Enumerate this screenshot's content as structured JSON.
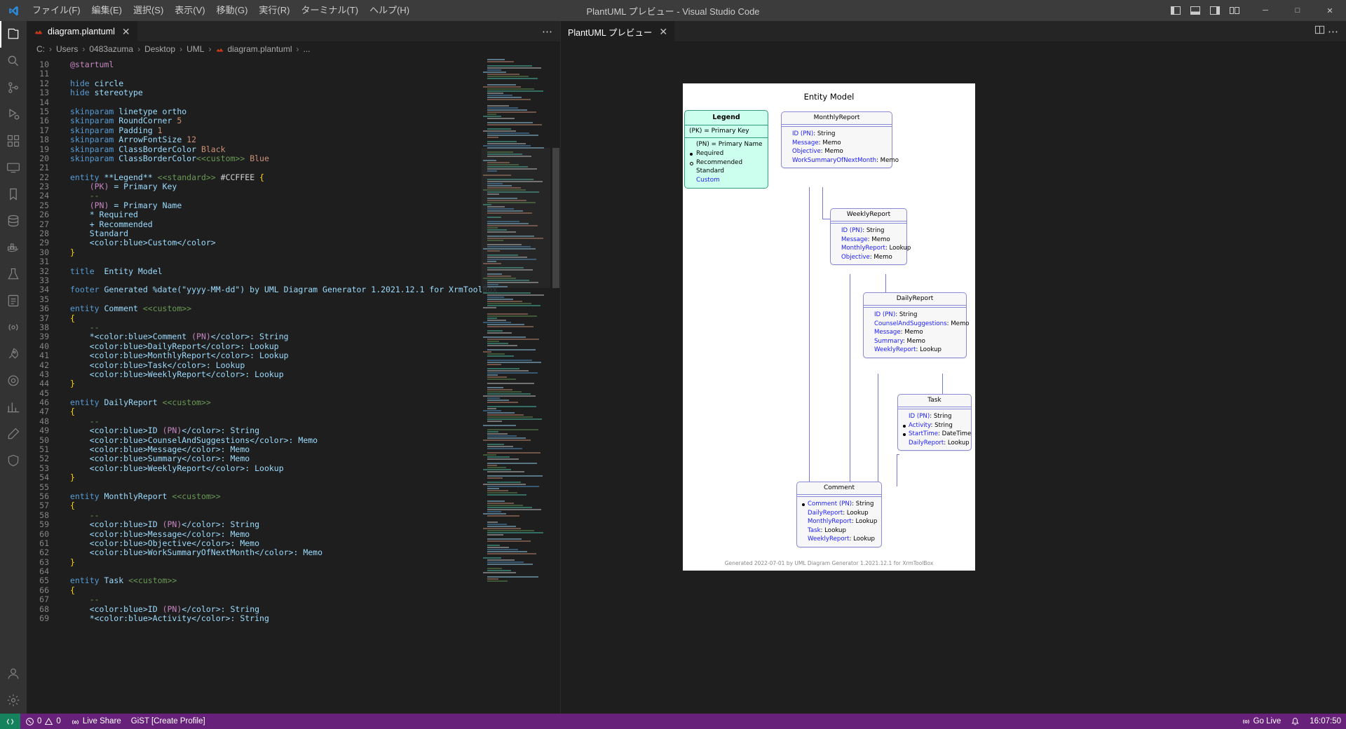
{
  "window": {
    "title": "PlantUML プレビュー - Visual Studio Code",
    "menus": [
      {
        "label": "ファイル(F)"
      },
      {
        "label": "編集(E)"
      },
      {
        "label": "選択(S)"
      },
      {
        "label": "表示(V)"
      },
      {
        "label": "移動(G)"
      },
      {
        "label": "実行(R)"
      },
      {
        "label": "ターミナル(T)"
      },
      {
        "label": "ヘルプ(H)"
      }
    ],
    "controls": {
      "minimize": "─",
      "maximize": "□",
      "close": "✕"
    }
  },
  "activitybar": {
    "items": [
      {
        "name": "explorer",
        "icon": "files-icon"
      },
      {
        "name": "search",
        "icon": "search-icon"
      },
      {
        "name": "source-control",
        "icon": "source-control-icon"
      },
      {
        "name": "run-debug",
        "icon": "run-debug-icon"
      },
      {
        "name": "extensions",
        "icon": "extensions-icon"
      },
      {
        "name": "remote-explorer",
        "icon": "remote-explorer-icon"
      },
      {
        "name": "bookmarks",
        "icon": "bookmark-icon"
      },
      {
        "name": "database",
        "icon": "database-icon"
      },
      {
        "name": "docker",
        "icon": "docker-icon"
      },
      {
        "name": "testing",
        "icon": "beaker-icon"
      },
      {
        "name": "todo-tree",
        "icon": "checklist-icon"
      },
      {
        "name": "live-share",
        "icon": "live-share-icon"
      },
      {
        "name": "rocket",
        "icon": "rocket-icon"
      },
      {
        "name": "settings-gear-alt",
        "icon": "gear-alt-icon"
      },
      {
        "name": "chart",
        "icon": "chart-icon"
      },
      {
        "name": "pencil",
        "icon": "pencil-icon"
      },
      {
        "name": "shield",
        "icon": "shield-icon"
      }
    ],
    "bottom": [
      {
        "name": "accounts",
        "icon": "account-icon"
      },
      {
        "name": "manage",
        "icon": "gear-icon"
      }
    ]
  },
  "editor": {
    "tab": {
      "label": "diagram.plantuml",
      "close": "✕",
      "icon": "plantuml-file-icon"
    },
    "tab_actions": {
      "more": "⋯"
    },
    "breadcrumb": [
      "C:",
      "Users",
      "0483azuma",
      "Desktop",
      "UML",
      "diagram.plantuml",
      "..."
    ],
    "breadcrumb_separator": "›",
    "first_line_number": 10,
    "code_lines": [
      {
        "n": 10,
        "tokens": [
          {
            "t": "@startuml",
            "c": "k-pink"
          }
        ]
      },
      {
        "n": 11,
        "tokens": []
      },
      {
        "n": 12,
        "tokens": [
          {
            "t": "hide ",
            "c": "k-blue"
          },
          {
            "t": "circle",
            "c": "k-lblue"
          }
        ]
      },
      {
        "n": 13,
        "tokens": [
          {
            "t": "hide ",
            "c": "k-blue"
          },
          {
            "t": "stereotype",
            "c": "k-lblue"
          }
        ]
      },
      {
        "n": 14,
        "tokens": []
      },
      {
        "n": 15,
        "tokens": [
          {
            "t": "skinparam ",
            "c": "k-blue"
          },
          {
            "t": "linetype ortho",
            "c": "k-lblue"
          }
        ]
      },
      {
        "n": 16,
        "tokens": [
          {
            "t": "skinparam ",
            "c": "k-blue"
          },
          {
            "t": "RoundCorner ",
            "c": "k-lblue"
          },
          {
            "t": "5",
            "c": "k-orange"
          }
        ]
      },
      {
        "n": 17,
        "tokens": [
          {
            "t": "skinparam ",
            "c": "k-blue"
          },
          {
            "t": "Padding ",
            "c": "k-lblue"
          },
          {
            "t": "1",
            "c": "k-orange"
          }
        ]
      },
      {
        "n": 18,
        "tokens": [
          {
            "t": "skinparam ",
            "c": "k-blue"
          },
          {
            "t": "ArrowFontSize ",
            "c": "k-lblue"
          },
          {
            "t": "12",
            "c": "k-orange"
          }
        ]
      },
      {
        "n": 19,
        "tokens": [
          {
            "t": "skinparam ",
            "c": "k-blue"
          },
          {
            "t": "ClassBorderColor ",
            "c": "k-lblue"
          },
          {
            "t": "Black",
            "c": "k-orange"
          }
        ]
      },
      {
        "n": 20,
        "tokens": [
          {
            "t": "skinparam ",
            "c": "k-blue"
          },
          {
            "t": "ClassBorderColor",
            "c": "k-lblue"
          },
          {
            "t": "<<custom>>",
            "c": "k-green"
          },
          {
            "t": " Blue",
            "c": "k-orange"
          }
        ]
      },
      {
        "n": 21,
        "tokens": []
      },
      {
        "n": 22,
        "tokens": [
          {
            "t": "entity ",
            "c": "k-blue"
          },
          {
            "t": "**Legend** ",
            "c": "k-lblue"
          },
          {
            "t": "<<standard>>",
            "c": "k-green"
          },
          {
            "t": " #CCFFEE ",
            "c": "k-white"
          },
          {
            "t": "{",
            "c": "k-brace"
          }
        ]
      },
      {
        "n": 23,
        "tokens": [
          {
            "t": "    ",
            "c": "k-white"
          },
          {
            "t": "(PK)",
            "c": "k-pink"
          },
          {
            "t": " = Primary Key",
            "c": "k-lblue"
          }
        ]
      },
      {
        "n": 24,
        "tokens": [
          {
            "t": "    --",
            "c": "k-green"
          }
        ]
      },
      {
        "n": 25,
        "tokens": [
          {
            "t": "    ",
            "c": "k-white"
          },
          {
            "t": "(PN)",
            "c": "k-pink"
          },
          {
            "t": " = Primary Name",
            "c": "k-lblue"
          }
        ]
      },
      {
        "n": 26,
        "tokens": [
          {
            "t": "    * Required",
            "c": "k-lblue"
          }
        ]
      },
      {
        "n": 27,
        "tokens": [
          {
            "t": "    + Recommended",
            "c": "k-lblue"
          }
        ]
      },
      {
        "n": 28,
        "tokens": [
          {
            "t": "    Standard",
            "c": "k-lblue"
          }
        ]
      },
      {
        "n": 29,
        "tokens": [
          {
            "t": "    <color:blue>Custom</color>",
            "c": "k-lblue"
          }
        ]
      },
      {
        "n": 30,
        "tokens": [
          {
            "t": "}",
            "c": "k-brace"
          }
        ]
      },
      {
        "n": 31,
        "tokens": []
      },
      {
        "n": 32,
        "tokens": [
          {
            "t": "title ",
            "c": "k-blue"
          },
          {
            "t": " Entity Model",
            "c": "k-lblue"
          }
        ]
      },
      {
        "n": 33,
        "tokens": []
      },
      {
        "n": 34,
        "tokens": [
          {
            "t": "footer ",
            "c": "k-blue"
          },
          {
            "t": "Generated %date(\"yyyy-MM-dd\") by UML Diagram Generator 1.2021.12.1 for XrmToolBox",
            "c": "k-lblue"
          }
        ]
      },
      {
        "n": 35,
        "tokens": []
      },
      {
        "n": 36,
        "tokens": [
          {
            "t": "entity ",
            "c": "k-blue"
          },
          {
            "t": "Comment ",
            "c": "k-lblue"
          },
          {
            "t": "<<custom>>",
            "c": "k-green"
          }
        ]
      },
      {
        "n": 37,
        "tokens": [
          {
            "t": "{",
            "c": "k-brace"
          }
        ]
      },
      {
        "n": 38,
        "tokens": [
          {
            "t": "    --",
            "c": "k-green"
          }
        ]
      },
      {
        "n": 39,
        "tokens": [
          {
            "t": "    *<color:blue>Comment ",
            "c": "k-lblue"
          },
          {
            "t": "(PN)",
            "c": "k-pink"
          },
          {
            "t": "</color>: String",
            "c": "k-lblue"
          }
        ]
      },
      {
        "n": 40,
        "tokens": [
          {
            "t": "    <color:blue>DailyReport</color>: Lookup",
            "c": "k-lblue"
          }
        ]
      },
      {
        "n": 41,
        "tokens": [
          {
            "t": "    <color:blue>MonthlyReport</color>: Lookup",
            "c": "k-lblue"
          }
        ]
      },
      {
        "n": 42,
        "tokens": [
          {
            "t": "    <color:blue>Task</color>: Lookup",
            "c": "k-lblue"
          }
        ]
      },
      {
        "n": 43,
        "tokens": [
          {
            "t": "    <color:blue>WeeklyReport</color>: Lookup",
            "c": "k-lblue"
          }
        ]
      },
      {
        "n": 44,
        "tokens": [
          {
            "t": "}",
            "c": "k-brace"
          }
        ]
      },
      {
        "n": 45,
        "tokens": []
      },
      {
        "n": 46,
        "tokens": [
          {
            "t": "entity ",
            "c": "k-blue"
          },
          {
            "t": "DailyReport ",
            "c": "k-lblue"
          },
          {
            "t": "<<custom>>",
            "c": "k-green"
          }
        ]
      },
      {
        "n": 47,
        "tokens": [
          {
            "t": "{",
            "c": "k-brace"
          }
        ]
      },
      {
        "n": 48,
        "tokens": [
          {
            "t": "    --",
            "c": "k-green"
          }
        ]
      },
      {
        "n": 49,
        "tokens": [
          {
            "t": "    <color:blue>ID ",
            "c": "k-lblue"
          },
          {
            "t": "(PN)",
            "c": "k-pink"
          },
          {
            "t": "</color>: String",
            "c": "k-lblue"
          }
        ]
      },
      {
        "n": 50,
        "tokens": [
          {
            "t": "    <color:blue>CounselAndSuggestions</color>: Memo",
            "c": "k-lblue"
          }
        ]
      },
      {
        "n": 51,
        "tokens": [
          {
            "t": "    <color:blue>Message</color>: Memo",
            "c": "k-lblue"
          }
        ]
      },
      {
        "n": 52,
        "tokens": [
          {
            "t": "    <color:blue>Summary</color>: Memo",
            "c": "k-lblue"
          }
        ]
      },
      {
        "n": 53,
        "tokens": [
          {
            "t": "    <color:blue>WeeklyReport</color>: Lookup",
            "c": "k-lblue"
          }
        ]
      },
      {
        "n": 54,
        "tokens": [
          {
            "t": "}",
            "c": "k-brace"
          }
        ]
      },
      {
        "n": 55,
        "tokens": []
      },
      {
        "n": 56,
        "tokens": [
          {
            "t": "entity ",
            "c": "k-blue"
          },
          {
            "t": "MonthlyReport ",
            "c": "k-lblue"
          },
          {
            "t": "<<custom>>",
            "c": "k-green"
          }
        ]
      },
      {
        "n": 57,
        "tokens": [
          {
            "t": "{",
            "c": "k-brace"
          }
        ]
      },
      {
        "n": 58,
        "tokens": [
          {
            "t": "    --",
            "c": "k-green"
          }
        ]
      },
      {
        "n": 59,
        "tokens": [
          {
            "t": "    <color:blue>ID ",
            "c": "k-lblue"
          },
          {
            "t": "(PN)",
            "c": "k-pink"
          },
          {
            "t": "</color>: String",
            "c": "k-lblue"
          }
        ]
      },
      {
        "n": 60,
        "tokens": [
          {
            "t": "    <color:blue>Message</color>: Memo",
            "c": "k-lblue"
          }
        ]
      },
      {
        "n": 61,
        "tokens": [
          {
            "t": "    <color:blue>Objective</color>: Memo",
            "c": "k-lblue"
          }
        ]
      },
      {
        "n": 62,
        "tokens": [
          {
            "t": "    <color:blue>WorkSummaryOfNextMonth</color>: Memo",
            "c": "k-lblue"
          }
        ]
      },
      {
        "n": 63,
        "tokens": [
          {
            "t": "}",
            "c": "k-brace"
          }
        ]
      },
      {
        "n": 64,
        "tokens": []
      },
      {
        "n": 65,
        "tokens": [
          {
            "t": "entity ",
            "c": "k-blue"
          },
          {
            "t": "Task ",
            "c": "k-lblue"
          },
          {
            "t": "<<custom>>",
            "c": "k-green"
          }
        ]
      },
      {
        "n": 66,
        "tokens": [
          {
            "t": "{",
            "c": "k-brace"
          }
        ]
      },
      {
        "n": 67,
        "tokens": [
          {
            "t": "    --",
            "c": "k-green"
          }
        ]
      },
      {
        "n": 68,
        "tokens": [
          {
            "t": "    <color:blue>ID ",
            "c": "k-lblue"
          },
          {
            "t": "(PN)",
            "c": "k-pink"
          },
          {
            "t": "</color>: String",
            "c": "k-lblue"
          }
        ]
      },
      {
        "n": 69,
        "tokens": [
          {
            "t": "    *<color:blue>Activity</color>: String",
            "c": "k-lblue"
          }
        ]
      }
    ]
  },
  "preview": {
    "tab_label": "PlantUML プレビュー",
    "tab_close": "✕",
    "actions": {
      "split": "split-editor-icon",
      "more": "⋯"
    }
  },
  "diagram": {
    "title": "Entity Model",
    "footer": "Generated 2022-07-01 by UML Diagram Generator 1.2021.12.1 for XrmToolBox",
    "legend": {
      "title": "Legend",
      "pk_line": "(PK) = Primary Key",
      "rows": [
        {
          "text": "(PN) = Primary Name",
          "marker": "none",
          "style": "plain"
        },
        {
          "text": "Required",
          "marker": "required",
          "style": "plain"
        },
        {
          "text": "Recommended",
          "marker": "recommended",
          "style": "plain"
        },
        {
          "text": "Standard",
          "marker": "none",
          "style": "plain"
        },
        {
          "text": "Custom",
          "marker": "none",
          "style": "custom"
        }
      ]
    },
    "entities": [
      {
        "name": "MonthlyReport",
        "fields": [
          {
            "name": "ID (PN)",
            "type": "String",
            "marker": "none"
          },
          {
            "name": "Message",
            "type": "Memo",
            "marker": "none"
          },
          {
            "name": "Objective",
            "type": "Memo",
            "marker": "none"
          },
          {
            "name": "WorkSummaryOfNextMonth",
            "type": "Memo",
            "marker": "none"
          }
        ]
      },
      {
        "name": "WeeklyReport",
        "fields": [
          {
            "name": "ID (PN)",
            "type": "String",
            "marker": "none"
          },
          {
            "name": "Message",
            "type": "Memo",
            "marker": "none"
          },
          {
            "name": "MonthlyReport",
            "type": "Lookup",
            "marker": "none"
          },
          {
            "name": "Objective",
            "type": "Memo",
            "marker": "none"
          }
        ]
      },
      {
        "name": "DailyReport",
        "fields": [
          {
            "name": "ID (PN)",
            "type": "String",
            "marker": "none"
          },
          {
            "name": "CounselAndSuggestions",
            "type": "Memo",
            "marker": "none"
          },
          {
            "name": "Message",
            "type": "Memo",
            "marker": "none"
          },
          {
            "name": "Summary",
            "type": "Memo",
            "marker": "none"
          },
          {
            "name": "WeeklyReport",
            "type": "Lookup",
            "marker": "none"
          }
        ]
      },
      {
        "name": "Task",
        "fields": [
          {
            "name": "ID (PN)",
            "type": "String",
            "marker": "none"
          },
          {
            "name": "Activity",
            "type": "String",
            "marker": "required"
          },
          {
            "name": "StartTime",
            "type": "DateTime",
            "marker": "required"
          },
          {
            "name": "DailyReport",
            "type": "Lookup",
            "marker": "none"
          }
        ]
      },
      {
        "name": "Comment",
        "fields": [
          {
            "name": "Comment (PN)",
            "type": "String",
            "marker": "required"
          },
          {
            "name": "DailyReport",
            "type": "Lookup",
            "marker": "none"
          },
          {
            "name": "MonthlyReport",
            "type": "Lookup",
            "marker": "none"
          },
          {
            "name": "Task",
            "type": "Lookup",
            "marker": "none"
          },
          {
            "name": "WeeklyReport",
            "type": "Lookup",
            "marker": "none"
          }
        ]
      }
    ]
  },
  "statusbar": {
    "remote_icon": "remote-indicator-icon",
    "problems": {
      "errors": "0",
      "warnings": "0"
    },
    "live_share": "Live Share",
    "gist": "GiST [Create Profile]",
    "go_live": "Go Live",
    "bell": "bell-icon",
    "time": "16:07:50"
  },
  "colors": {
    "accent": "#68217a",
    "legend_fill": "#CCFFEE",
    "custom_blue": "#1a1aff",
    "entity_border": "#8a8ad8"
  }
}
